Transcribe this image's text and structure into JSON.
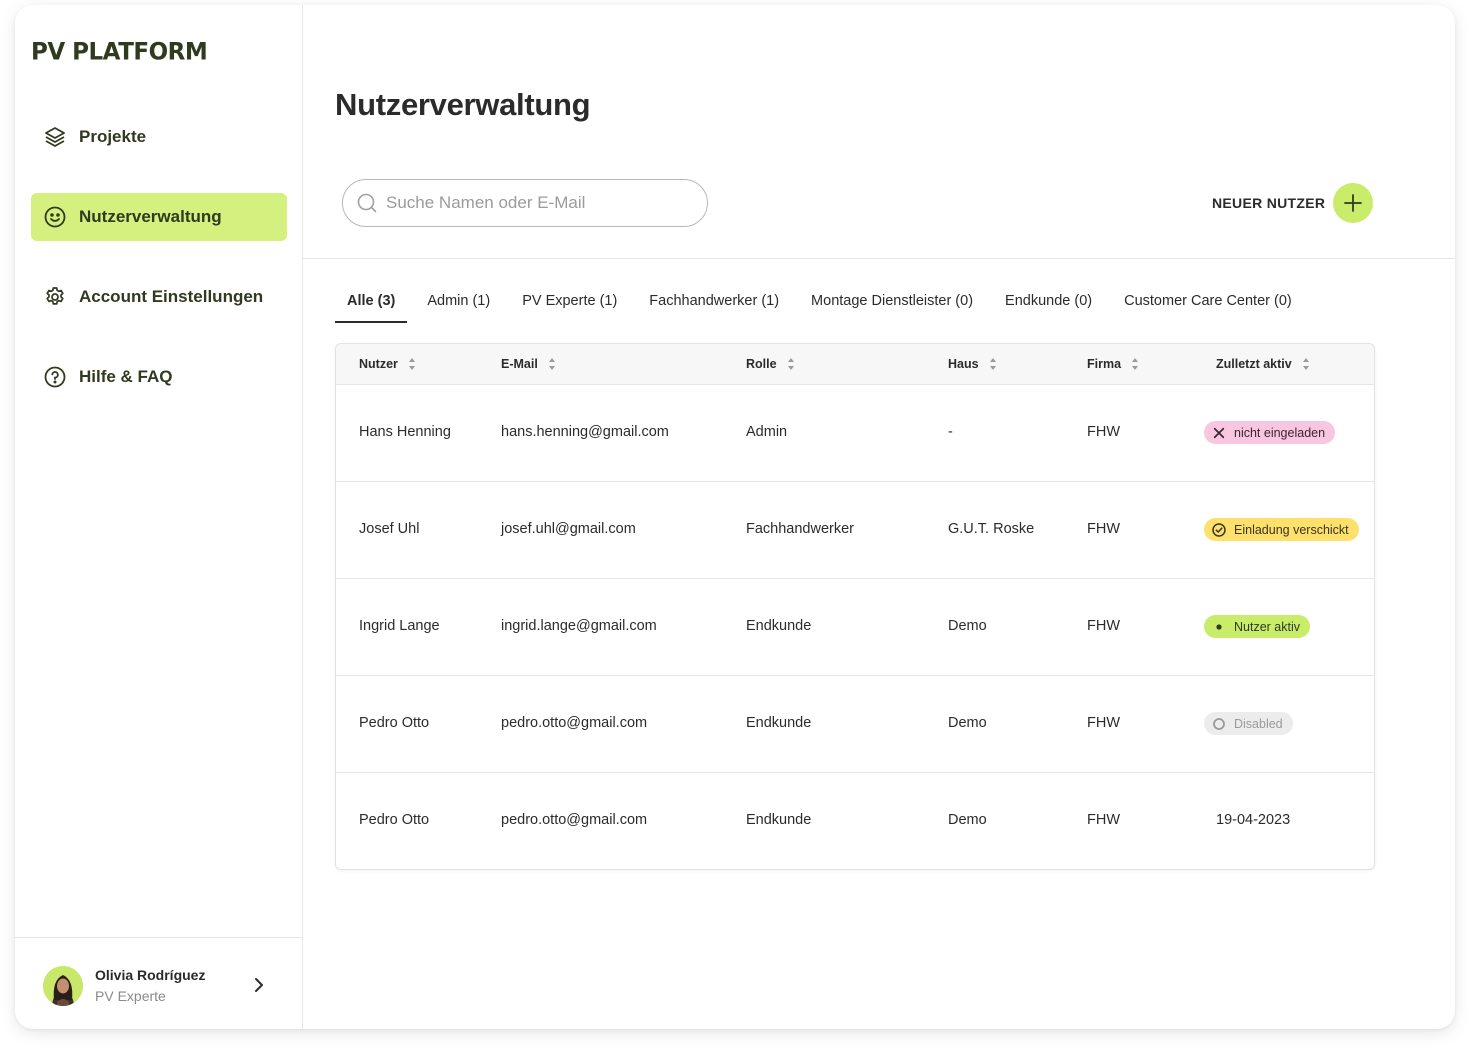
{
  "app": {
    "logo": "PV PLATFORM"
  },
  "sidebar": {
    "items": [
      {
        "label": "Projekte",
        "icon": "layers-icon",
        "active": false
      },
      {
        "label": "Nutzerverwaltung",
        "icon": "smiley-icon",
        "active": true
      },
      {
        "label": "Account Einstellungen",
        "icon": "gear-icon",
        "active": false
      },
      {
        "label": "Hilfe & FAQ",
        "icon": "help-circle-icon",
        "active": false
      }
    ],
    "user": {
      "name": "Olivia Rodríguez",
      "role": "PV Experte"
    }
  },
  "main": {
    "title": "Nutzerverwaltung",
    "search": {
      "placeholder": "Suche Namen oder E-Mail",
      "value": ""
    },
    "new_user_label": "NEUER NUTZER",
    "tabs": [
      {
        "label": "Alle (3)",
        "active": true
      },
      {
        "label": "Admin (1)"
      },
      {
        "label": "PV Experte (1)"
      },
      {
        "label": "Fachhandwerker (1)"
      },
      {
        "label": "Montage Dienstleister (0)"
      },
      {
        "label": "Endkunde (0)"
      },
      {
        "label": "Customer Care Center (0)"
      }
    ],
    "table": {
      "columns": [
        "Nutzer",
        "E-Mail",
        "Rolle",
        "Haus",
        "Firma",
        "Zulletzt aktiv"
      ],
      "rows": [
        {
          "name": "Hans Henning",
          "email": "hans.henning@gmail.com",
          "role": "Admin",
          "house": "-",
          "company": "FHW",
          "status": {
            "type": "pink",
            "icon": "x-icon",
            "label": "nicht eingeladen"
          }
        },
        {
          "name": "Josef Uhl",
          "email": "josef.uhl@gmail.com",
          "role": "Fachhandwerker",
          "house": "G.U.T. Roske",
          "company": "FHW",
          "status": {
            "type": "yellow",
            "icon": "check-circle-icon",
            "label": "Einladung verschickt"
          }
        },
        {
          "name": "Ingrid Lange",
          "email": "ingrid.lange@gmail.com",
          "role": "Endkunde",
          "house": "Demo",
          "company": "FHW",
          "status": {
            "type": "green",
            "icon": "dot-icon",
            "label": "Nutzer aktiv"
          }
        },
        {
          "name": "Pedro Otto",
          "email": "pedro.otto@gmail.com",
          "role": "Endkunde",
          "house": "Demo",
          "company": "FHW",
          "status": {
            "type": "grey",
            "icon": "circle-icon",
            "label": "Disabled"
          }
        },
        {
          "name": "Pedro Otto",
          "email": "pedro.otto@gmail.com",
          "role": "Endkunde",
          "house": "Demo",
          "company": "FHW",
          "status": {
            "type": "text",
            "label": "19-04-2023"
          }
        }
      ]
    }
  },
  "colors": {
    "accent": "#d4f07e",
    "brand_dark": "#2f3a1e",
    "pink": "#f9c6e0",
    "yellow": "#fde16c",
    "green": "#c9ec6a",
    "grey": "#ececec"
  }
}
